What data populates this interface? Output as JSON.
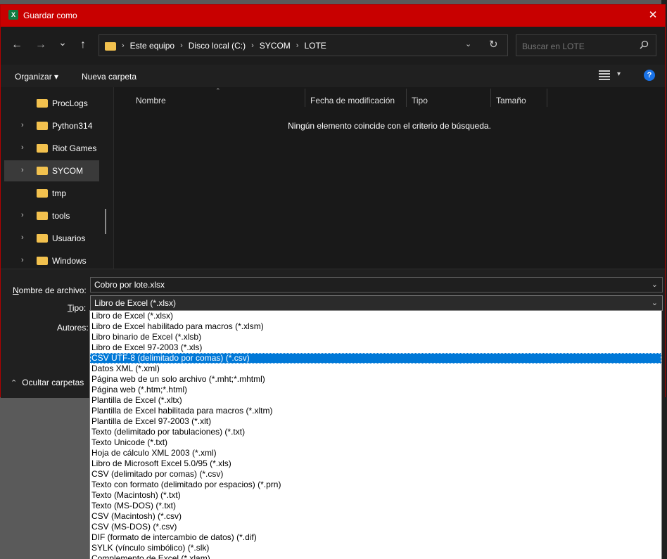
{
  "window": {
    "title": "Guardar como",
    "app_icon_label": "X",
    "close_symbol": "✕",
    "accent_color": "#c80000"
  },
  "nav": {
    "back_symbol": "←",
    "forward_symbol": "→",
    "recent_symbol": "⌄",
    "up_symbol": "↑",
    "breadcrumbs": [
      "Este equipo",
      "Disco local (C:)",
      "SYCOM",
      "LOTE"
    ],
    "separator": "›",
    "dropdown_symbol": "⌄",
    "refresh_symbol": "↻"
  },
  "search": {
    "placeholder": "Buscar en LOTE",
    "icon": "search-icon"
  },
  "toolbar": {
    "organize_label": "Organizar ▾",
    "new_folder_label": "Nueva carpeta",
    "view_dropdown_symbol": "▾",
    "help_symbol": "?"
  },
  "tree": {
    "items": [
      {
        "label": "ProcLogs",
        "expandable": false,
        "selected": false
      },
      {
        "label": "Python314",
        "expandable": true,
        "selected": false
      },
      {
        "label": "Riot Games",
        "expandable": true,
        "selected": false
      },
      {
        "label": "SYCOM",
        "expandable": true,
        "selected": true
      },
      {
        "label": "tmp",
        "expandable": false,
        "selected": false
      },
      {
        "label": "tools",
        "expandable": true,
        "selected": false
      },
      {
        "label": "Usuarios",
        "expandable": true,
        "selected": false
      },
      {
        "label": "Windows",
        "expandable": true,
        "selected": false
      }
    ],
    "chevron": "›"
  },
  "files": {
    "columns": [
      "Nombre",
      "Fecha de modificación",
      "Tipo",
      "Tamaño"
    ],
    "sort_indicator": "⌃",
    "empty_message": "Ningún elemento coincide con el criterio de búsqueda."
  },
  "form": {
    "filename_label": "Nombre de archivo:",
    "filename_label_accel": "N",
    "filename_label_rest": "ombre de archivo:",
    "filename_value": "Cobro por lote.xlsx",
    "type_label_accel": "T",
    "type_label_rest": "ipo:",
    "type_value": "Libro de Excel (*.xlsx)",
    "authors_label": "Autores:",
    "hide_folders_label": "Ocultar carpetas",
    "hide_folders_symbol": "⌃",
    "dd_symbol": "⌄"
  },
  "type_options": [
    "Libro de Excel (*.xlsx)",
    "Libro de Excel habilitado para macros (*.xlsm)",
    "Libro binario de Excel (*.xlsb)",
    "Libro de Excel 97-2003 (*.xls)",
    "CSV UTF-8 (delimitado por comas) (*.csv)",
    "Datos XML (*.xml)",
    "Página web de un solo archivo (*.mht;*.mhtml)",
    "Página web (*.htm;*.html)",
    "Plantilla de Excel (*.xltx)",
    "Plantilla de Excel habilitada para macros (*.xltm)",
    "Plantilla de Excel 97-2003 (*.xlt)",
    "Texto (delimitado por tabulaciones) (*.txt)",
    "Texto Unicode (*.txt)",
    "Hoja de cálculo XML 2003 (*.xml)",
    "Libro de Microsoft Excel 5.0/95 (*.xls)",
    "CSV (delimitado por comas) (*.csv)",
    "Texto con formato (delimitado por espacios) (*.prn)",
    "Texto (Macintosh) (*.txt)",
    "Texto (MS-DOS) (*.txt)",
    "CSV (Macintosh) (*.csv)",
    "CSV (MS-DOS) (*.csv)",
    "DIF (formato de intercambio de datos) (*.dif)",
    "SYLK (vínculo simbólico) (*.slk)",
    "Complemento de Excel (*.xlam)"
  ],
  "type_selected_index": 4
}
